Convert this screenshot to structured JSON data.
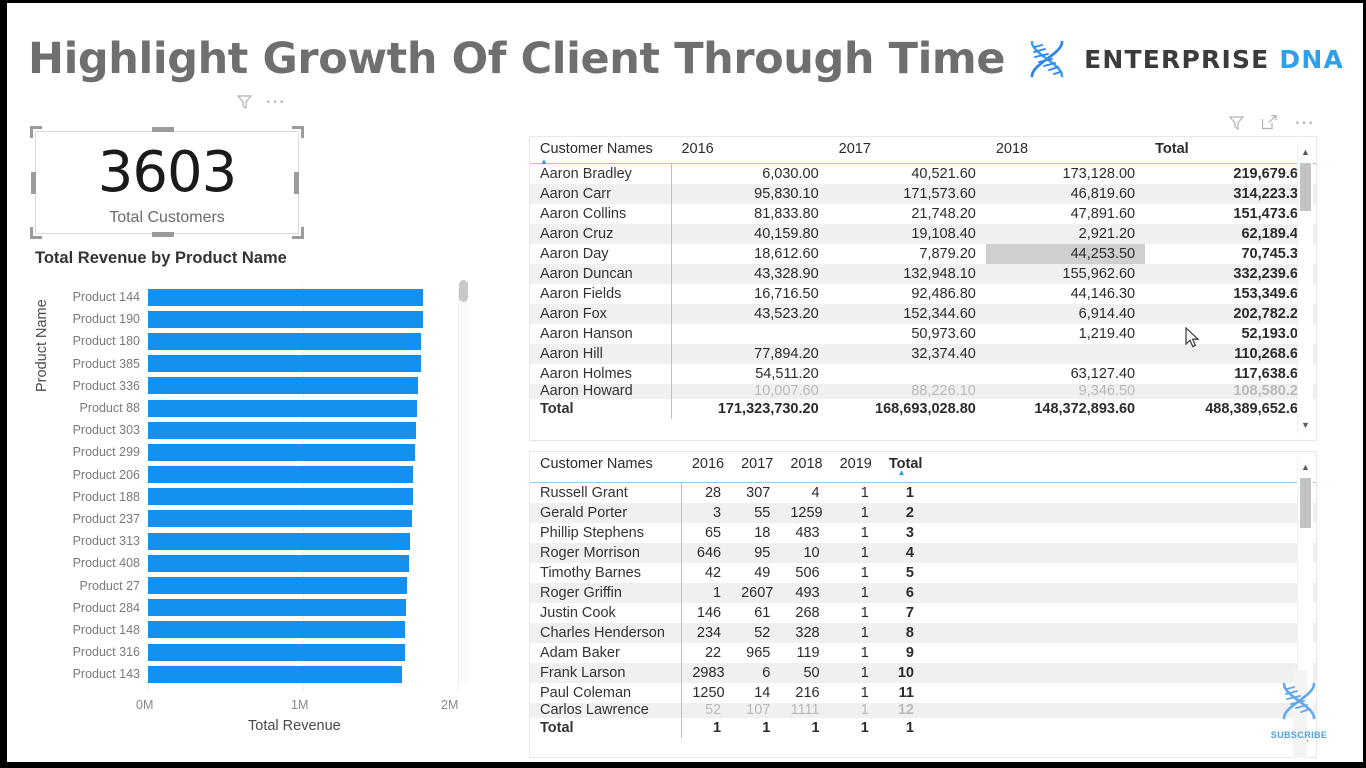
{
  "page": {
    "title": "Highlight Growth Of Client Through Time",
    "brand_word1": "ENTERPRISE",
    "brand_word2": "DNA",
    "subscribe_label": "SUBSCRIBE",
    "accent_blue": "#1490f0",
    "title_color": "#6f6f6f",
    "brand_blue": "#2f9fea",
    "header_rule_blue": "#8fd0f0"
  },
  "card": {
    "value": "3603",
    "label": "Total Customers",
    "filter_icon": "filter-icon",
    "more_icon": "more-options-icon"
  },
  "bar_chart": {
    "title": "Total Revenue by Product Name",
    "y_axis_title": "Product Name",
    "x_axis_title": "Total Revenue",
    "x_ticks": [
      "0M",
      "1M",
      "2M"
    ]
  },
  "chart_data": {
    "type": "bar",
    "title": "Total Revenue by Product Name",
    "xlabel": "Total Revenue",
    "ylabel": "Product Name",
    "orientation": "horizontal",
    "xlim": [
      0,
      2000000
    ],
    "grid": true,
    "categories": [
      "Product 144",
      "Product 190",
      "Product 180",
      "Product 385",
      "Product 336",
      "Product 88",
      "Product 303",
      "Product 299",
      "Product 206",
      "Product 188",
      "Product 237",
      "Product 313",
      "Product 408",
      "Product 27",
      "Product 284",
      "Product 148",
      "Product 316",
      "Product 143"
    ],
    "values": [
      1776000,
      1771000,
      1763000,
      1761000,
      1745000,
      1738000,
      1730000,
      1720000,
      1712000,
      1710000,
      1700000,
      1689000,
      1681000,
      1672000,
      1665000,
      1660000,
      1657000,
      1638000
    ]
  },
  "matrix_revenue": {
    "toolbar": [
      "filter-icon",
      "focus-mode-icon",
      "more-options-icon"
    ],
    "columns": [
      "Customer Names",
      "2016",
      "2017",
      "2018",
      "Total"
    ],
    "sort_column": "Customer Names",
    "sort_direction": "ascending",
    "highlighted_cell": {
      "row": "Aaron Day",
      "column": "2018",
      "value": "44,253.50"
    },
    "rows": [
      {
        "name": "Aaron Bradley",
        "v2016": "6,030.00",
        "v2017": "40,521.60",
        "v2018": "173,128.00",
        "total": "219,679.60"
      },
      {
        "name": "Aaron Carr",
        "v2016": "95,830.10",
        "v2017": "171,573.60",
        "v2018": "46,819.60",
        "total": "314,223.30"
      },
      {
        "name": "Aaron Collins",
        "v2016": "81,833.80",
        "v2017": "21,748.20",
        "v2018": "47,891.60",
        "total": "151,473.60"
      },
      {
        "name": "Aaron Cruz",
        "v2016": "40,159.80",
        "v2017": "19,108.40",
        "v2018": "2,921.20",
        "total": "62,189.40"
      },
      {
        "name": "Aaron Day",
        "v2016": "18,612.60",
        "v2017": "7,879.20",
        "v2018": "44,253.50",
        "total": "70,745.30"
      },
      {
        "name": "Aaron Duncan",
        "v2016": "43,328.90",
        "v2017": "132,948.10",
        "v2018": "155,962.60",
        "total": "332,239.60"
      },
      {
        "name": "Aaron Fields",
        "v2016": "16,716.50",
        "v2017": "92,486.80",
        "v2018": "44,146.30",
        "total": "153,349.60"
      },
      {
        "name": "Aaron Fox",
        "v2016": "43,523.20",
        "v2017": "152,344.60",
        "v2018": "6,914.40",
        "total": "202,782.20"
      },
      {
        "name": "Aaron Hanson",
        "v2016": "",
        "v2017": "50,973.60",
        "v2018": "1,219.40",
        "total": "52,193.00"
      },
      {
        "name": "Aaron Hill",
        "v2016": "77,894.20",
        "v2017": "32,374.40",
        "v2018": "",
        "total": "110,268.60"
      },
      {
        "name": "Aaron Holmes",
        "v2016": "54,511.20",
        "v2017": "",
        "v2018": "63,127.40",
        "total": "117,638.60"
      },
      {
        "name": "Aaron Howard",
        "v2016": "10,007.60",
        "v2017": "88,226.10",
        "v2018": "9,346.50",
        "total": "108,580.20"
      }
    ],
    "total_row": {
      "name": "Total",
      "v2016": "171,323,730.20",
      "v2017": "168,693,028.80",
      "v2018": "148,372,893.60",
      "total": "488,389,652.60"
    }
  },
  "matrix_rank": {
    "columns": [
      "Customer Names",
      "2016",
      "2017",
      "2018",
      "2019",
      "Total"
    ],
    "sort_column": "Total",
    "sort_direction": "ascending",
    "rows": [
      {
        "name": "Russell Grant",
        "v2016": "28",
        "v2017": "307",
        "v2018": "4",
        "v2019": "1",
        "total": "1"
      },
      {
        "name": "Gerald Porter",
        "v2016": "3",
        "v2017": "55",
        "v2018": "1259",
        "v2019": "1",
        "total": "2"
      },
      {
        "name": "Phillip Stephens",
        "v2016": "65",
        "v2017": "18",
        "v2018": "483",
        "v2019": "1",
        "total": "3"
      },
      {
        "name": "Roger Morrison",
        "v2016": "646",
        "v2017": "95",
        "v2018": "10",
        "v2019": "1",
        "total": "4"
      },
      {
        "name": "Timothy Barnes",
        "v2016": "42",
        "v2017": "49",
        "v2018": "506",
        "v2019": "1",
        "total": "5"
      },
      {
        "name": "Roger Griffin",
        "v2016": "1",
        "v2017": "2607",
        "v2018": "493",
        "v2019": "1",
        "total": "6"
      },
      {
        "name": "Justin Cook",
        "v2016": "146",
        "v2017": "61",
        "v2018": "268",
        "v2019": "1",
        "total": "7"
      },
      {
        "name": "Charles Henderson",
        "v2016": "234",
        "v2017": "52",
        "v2018": "328",
        "v2019": "1",
        "total": "8"
      },
      {
        "name": "Adam Baker",
        "v2016": "22",
        "v2017": "965",
        "v2018": "119",
        "v2019": "1",
        "total": "9"
      },
      {
        "name": "Frank Larson",
        "v2016": "2983",
        "v2017": "6",
        "v2018": "50",
        "v2019": "1",
        "total": "10"
      },
      {
        "name": "Paul Coleman",
        "v2016": "1250",
        "v2017": "14",
        "v2018": "216",
        "v2019": "1",
        "total": "11"
      },
      {
        "name": "Carlos Lawrence",
        "v2016": "52",
        "v2017": "107",
        "v2018": "1111",
        "v2019": "1",
        "total": "12"
      }
    ],
    "total_row": {
      "name": "Total",
      "v2016": "1",
      "v2017": "1",
      "v2018": "1",
      "v2019": "1",
      "total": "1"
    }
  }
}
